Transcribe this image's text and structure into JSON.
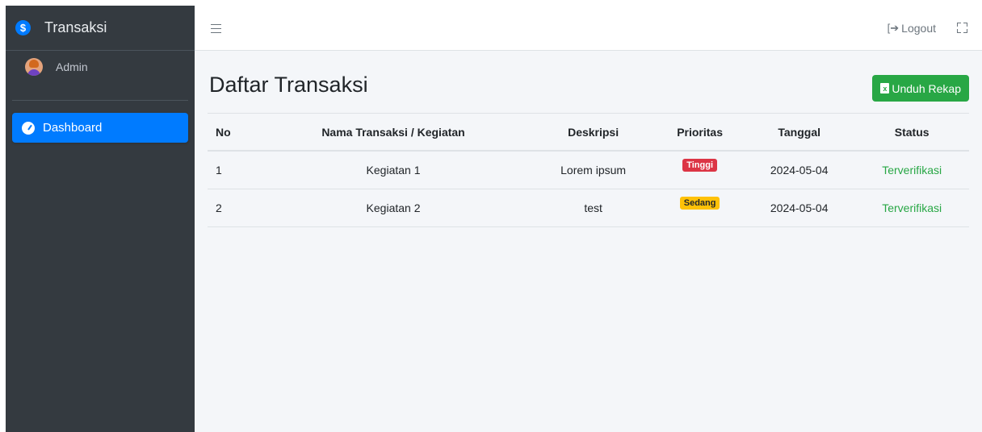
{
  "brand": {
    "logo_symbol": "$",
    "title": "Transaksi"
  },
  "user": {
    "name": "Admin"
  },
  "sidebar": {
    "items": [
      {
        "label": "Dashboard",
        "icon": "tachometer-icon",
        "active": true
      }
    ]
  },
  "topbar": {
    "logout_label": "Logout",
    "logout_icon": "sign-out-icon",
    "fullscreen_icon": "expand-icon"
  },
  "page": {
    "title": "Daftar Transaksi",
    "download_button_label": "Unduh Rekap",
    "download_icon": "excel-file-icon"
  },
  "table": {
    "headers": [
      "No",
      "Nama Transaksi / Kegiatan",
      "Deskripsi",
      "Prioritas",
      "Tanggal",
      "Status"
    ],
    "rows": [
      {
        "no": "1",
        "nama": "Kegiatan 1",
        "deskripsi": "Lorem ipsum",
        "prioritas": "Tinggi",
        "tanggal": "2024-05-04",
        "status": "Terverifikasi"
      },
      {
        "no": "2",
        "nama": "Kegiatan 2",
        "deskripsi": "test",
        "prioritas": "Sedang",
        "tanggal": "2024-05-04",
        "status": "Terverifikasi"
      }
    ]
  },
  "colors": {
    "sidebar_bg": "#343a40",
    "active_nav": "#007bff",
    "success": "#28a745",
    "danger": "#dc3545",
    "warning": "#ffc107"
  }
}
